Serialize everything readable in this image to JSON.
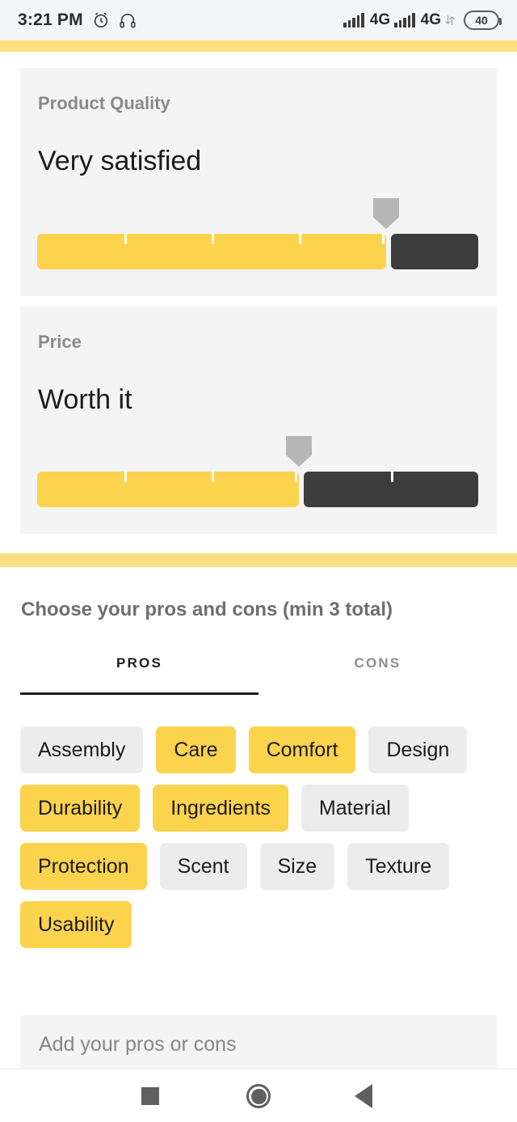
{
  "status_bar": {
    "time": "3:21 PM",
    "alarm_icon": "alarm-clock-icon",
    "headphones_icon": "headphones-icon",
    "signal_1": "signal-bars-icon",
    "network_1": "4G",
    "signal_2": "signal-bars-icon",
    "network_2": "4G",
    "data_transfer_icon": "data-transfer-arrows-icon",
    "battery_level": "40"
  },
  "theme": {
    "accent": "#fcd34d",
    "band": "#fcdf80",
    "card_bg": "#f4f4f4",
    "track_empty": "#3d3d3d",
    "marker": "#b6b6b6",
    "chip_bg": "#ececec"
  },
  "ratings": [
    {
      "label": "Product Quality",
      "value_text": "Very satisfied",
      "score": 4,
      "max": 5
    },
    {
      "label": "Price",
      "value_text": "Worth it",
      "score": 3,
      "max": 5
    }
  ],
  "pros_cons": {
    "title": "Choose your pros and cons (min 3 total)",
    "tabs": [
      {
        "label": "PROS",
        "active": true
      },
      {
        "label": "CONS",
        "active": false
      }
    ],
    "chips": [
      {
        "label": "Assembly",
        "selected": false
      },
      {
        "label": "Care",
        "selected": true
      },
      {
        "label": "Comfort",
        "selected": true
      },
      {
        "label": "Design",
        "selected": false
      },
      {
        "label": "Durability",
        "selected": true
      },
      {
        "label": "Ingredients",
        "selected": true
      },
      {
        "label": "Material",
        "selected": false
      },
      {
        "label": "Protection",
        "selected": true
      },
      {
        "label": "Scent",
        "selected": false
      },
      {
        "label": "Size",
        "selected": false
      },
      {
        "label": "Texture",
        "selected": false
      },
      {
        "label": "Usability",
        "selected": true
      }
    ],
    "custom_input": {
      "value": "",
      "placeholder": "Add your pros or cons"
    }
  },
  "nav_bar": {
    "recents": "square-recents-icon",
    "home": "circle-home-icon",
    "back": "triangle-back-icon"
  }
}
